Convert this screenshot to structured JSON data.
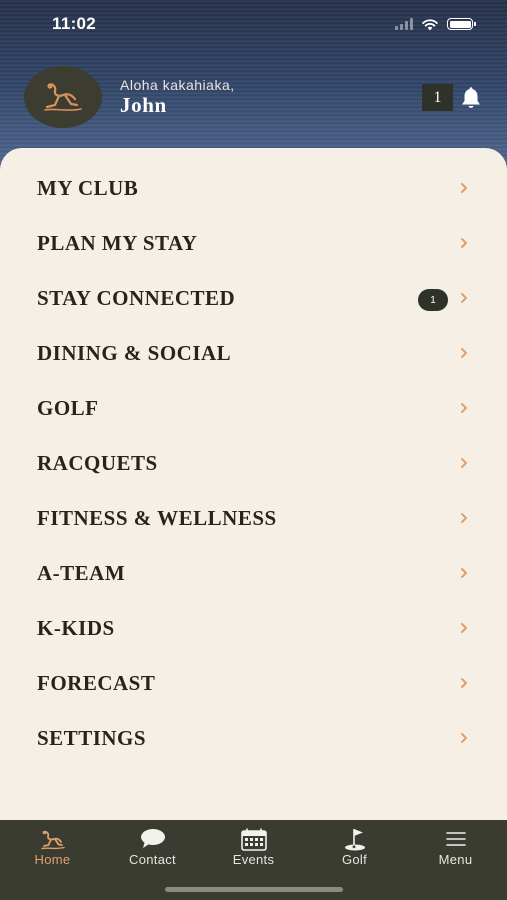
{
  "status": {
    "time": "11:02"
  },
  "header": {
    "greeting": "Aloha kakahiaka,",
    "user_name": "John",
    "notification_count": "1"
  },
  "menu": {
    "items": [
      {
        "label": "MY CLUB"
      },
      {
        "label": "PLAN MY STAY"
      },
      {
        "label": "STAY CONNECTED",
        "badge": "1"
      },
      {
        "label": "DINING & SOCIAL"
      },
      {
        "label": "GOLF"
      },
      {
        "label": "RACQUETS"
      },
      {
        "label": "FITNESS & WELLNESS"
      },
      {
        "label": "A-TEAM"
      },
      {
        "label": "K-KIDS"
      },
      {
        "label": "FORECAST"
      },
      {
        "label": "SETTINGS"
      }
    ]
  },
  "tabbar": {
    "tabs": [
      {
        "label": "Home",
        "icon": "home-logo-icon",
        "active": true
      },
      {
        "label": "Contact",
        "icon": "chat-bubble-icon"
      },
      {
        "label": "Events",
        "icon": "calendar-icon"
      },
      {
        "label": "Golf",
        "icon": "golf-flag-icon"
      },
      {
        "label": "Menu",
        "icon": "hamburger-menu-icon"
      }
    ]
  },
  "colors": {
    "accent": "#e0a06c",
    "sheet_background": "#f6efe5",
    "tabbar_background": "#3a3b31",
    "badge_background": "#2f3229",
    "text_dark": "#26241f"
  }
}
